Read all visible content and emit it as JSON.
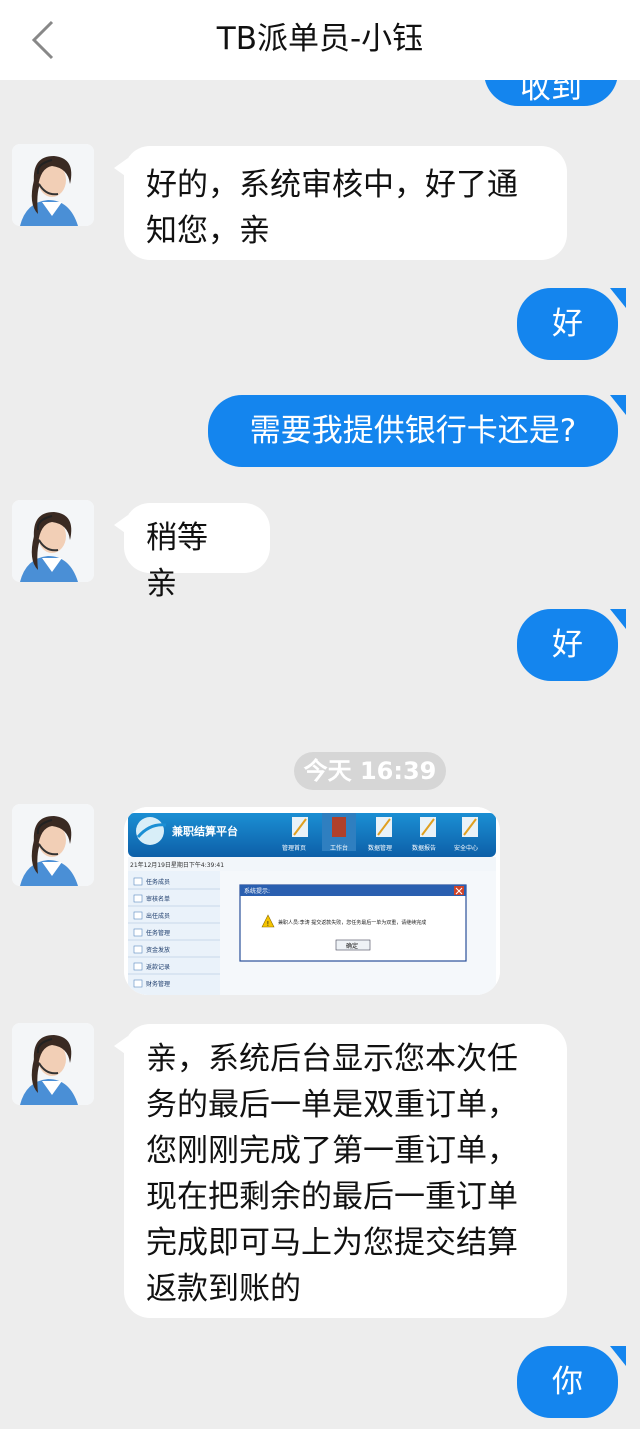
{
  "header": {
    "title": "TB派单员-小钰",
    "back_icon": "chevron-left-icon"
  },
  "messages": [
    {
      "side": "right",
      "text": "收到了"
    },
    {
      "side": "left",
      "text": "好的，系统审核中，好了通知您，亲"
    },
    {
      "side": "right",
      "text": "好"
    },
    {
      "side": "right",
      "text": "需要我提供银行卡还是?"
    },
    {
      "side": "left",
      "text": "稍等 亲"
    },
    {
      "side": "right",
      "text": "好"
    },
    {
      "side": "left",
      "text": "亲，系统后台显示您本次任务的最后一单是双重订单，您刚刚完成了第一重订单，现在把剩余的最后一重订单完成即可马上为您提交结算返款到账的"
    },
    {
      "side": "right",
      "text": "你"
    }
  ],
  "timestamp": "今天 16:39",
  "screenshot_image": {
    "platform_name": "兼职结算平台",
    "nav_items": [
      "管理首页",
      "工作台",
      "数据管理",
      "数据报告",
      "安全中心"
    ],
    "date_line": "21年12月19日星期日下午4:39:41",
    "sidebar_items": [
      "任务成员",
      "审核名单",
      "出任成员",
      "任务管理",
      "资金发放",
      "返款记录",
      "财务管理"
    ],
    "dialog_title": "系统提示:",
    "dialog_message": "兼职人员:李涛  提交返款失败，您任务最后一单为双重，请继续完成",
    "dialog_button": "确定"
  },
  "colors": {
    "accent": "#1485ee",
    "background": "#ededed",
    "bubble_left": "#ffffff"
  }
}
